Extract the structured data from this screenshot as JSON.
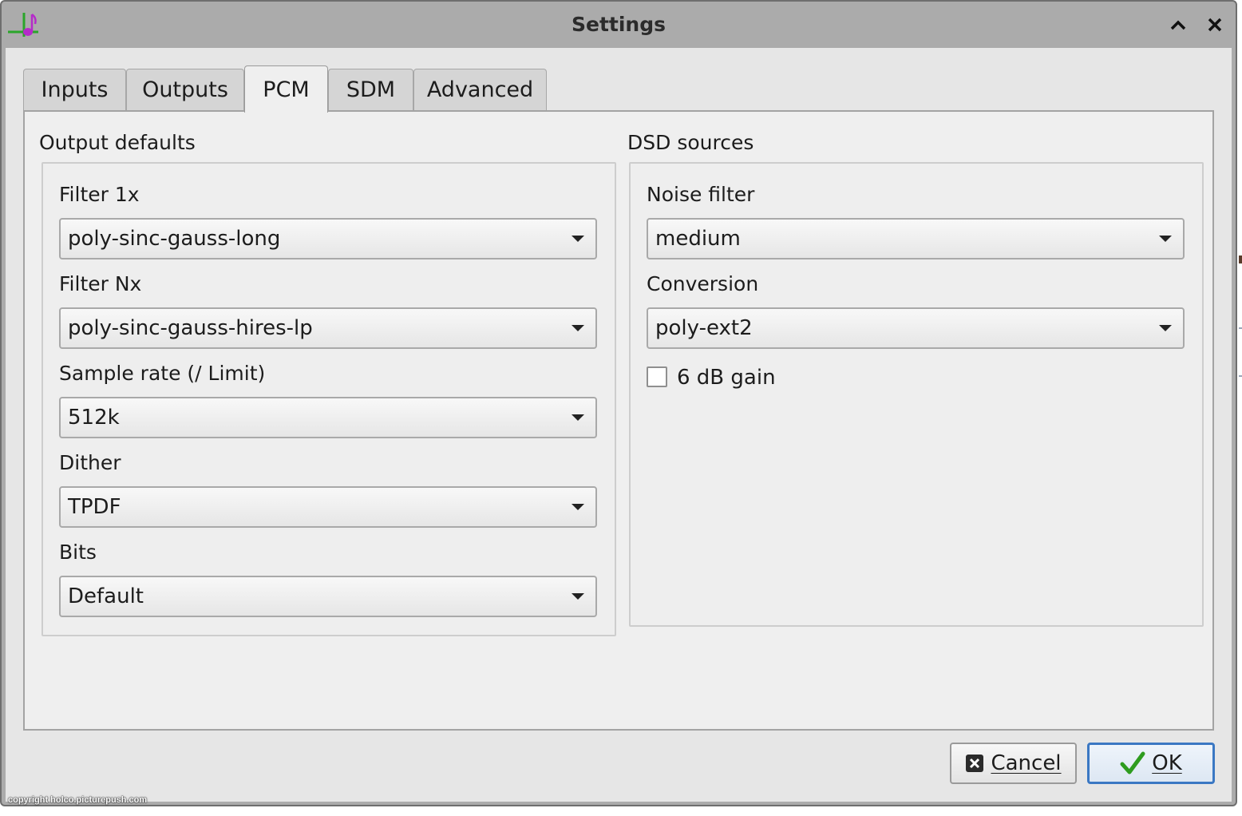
{
  "window": {
    "title": "Settings"
  },
  "tabs": [
    {
      "label": "Inputs",
      "active": false
    },
    {
      "label": "Outputs",
      "active": false
    },
    {
      "label": "PCM",
      "active": true
    },
    {
      "label": "SDM",
      "active": false
    },
    {
      "label": "Advanced",
      "active": false
    }
  ],
  "output_defaults": {
    "title": "Output defaults",
    "filter_1x": {
      "label": "Filter 1x",
      "value": "poly-sinc-gauss-long"
    },
    "filter_nx": {
      "label": "Filter Nx",
      "value": "poly-sinc-gauss-hires-lp"
    },
    "sample_rate": {
      "label": "Sample rate (/ Limit)",
      "value": "512k"
    },
    "dither": {
      "label": "Dither",
      "value": "TPDF"
    },
    "bits": {
      "label": "Bits",
      "value": "Default"
    }
  },
  "dsd_sources": {
    "title": "DSD sources",
    "noise_filter": {
      "label": "Noise filter",
      "value": "medium"
    },
    "conversion": {
      "label": "Conversion",
      "value": "poly-ext2"
    },
    "gain": {
      "label": "6 dB gain",
      "checked": false
    }
  },
  "buttons": {
    "cancel": "Cancel",
    "ok": "OK"
  },
  "watermark": "copyright holco.picturepush.com",
  "colors": {
    "ok_check": "#2e9c1f",
    "default_button_border": "#3b78c3",
    "app_icon_purple": "#b52bc9",
    "app_icon_green": "#2aa62a"
  }
}
